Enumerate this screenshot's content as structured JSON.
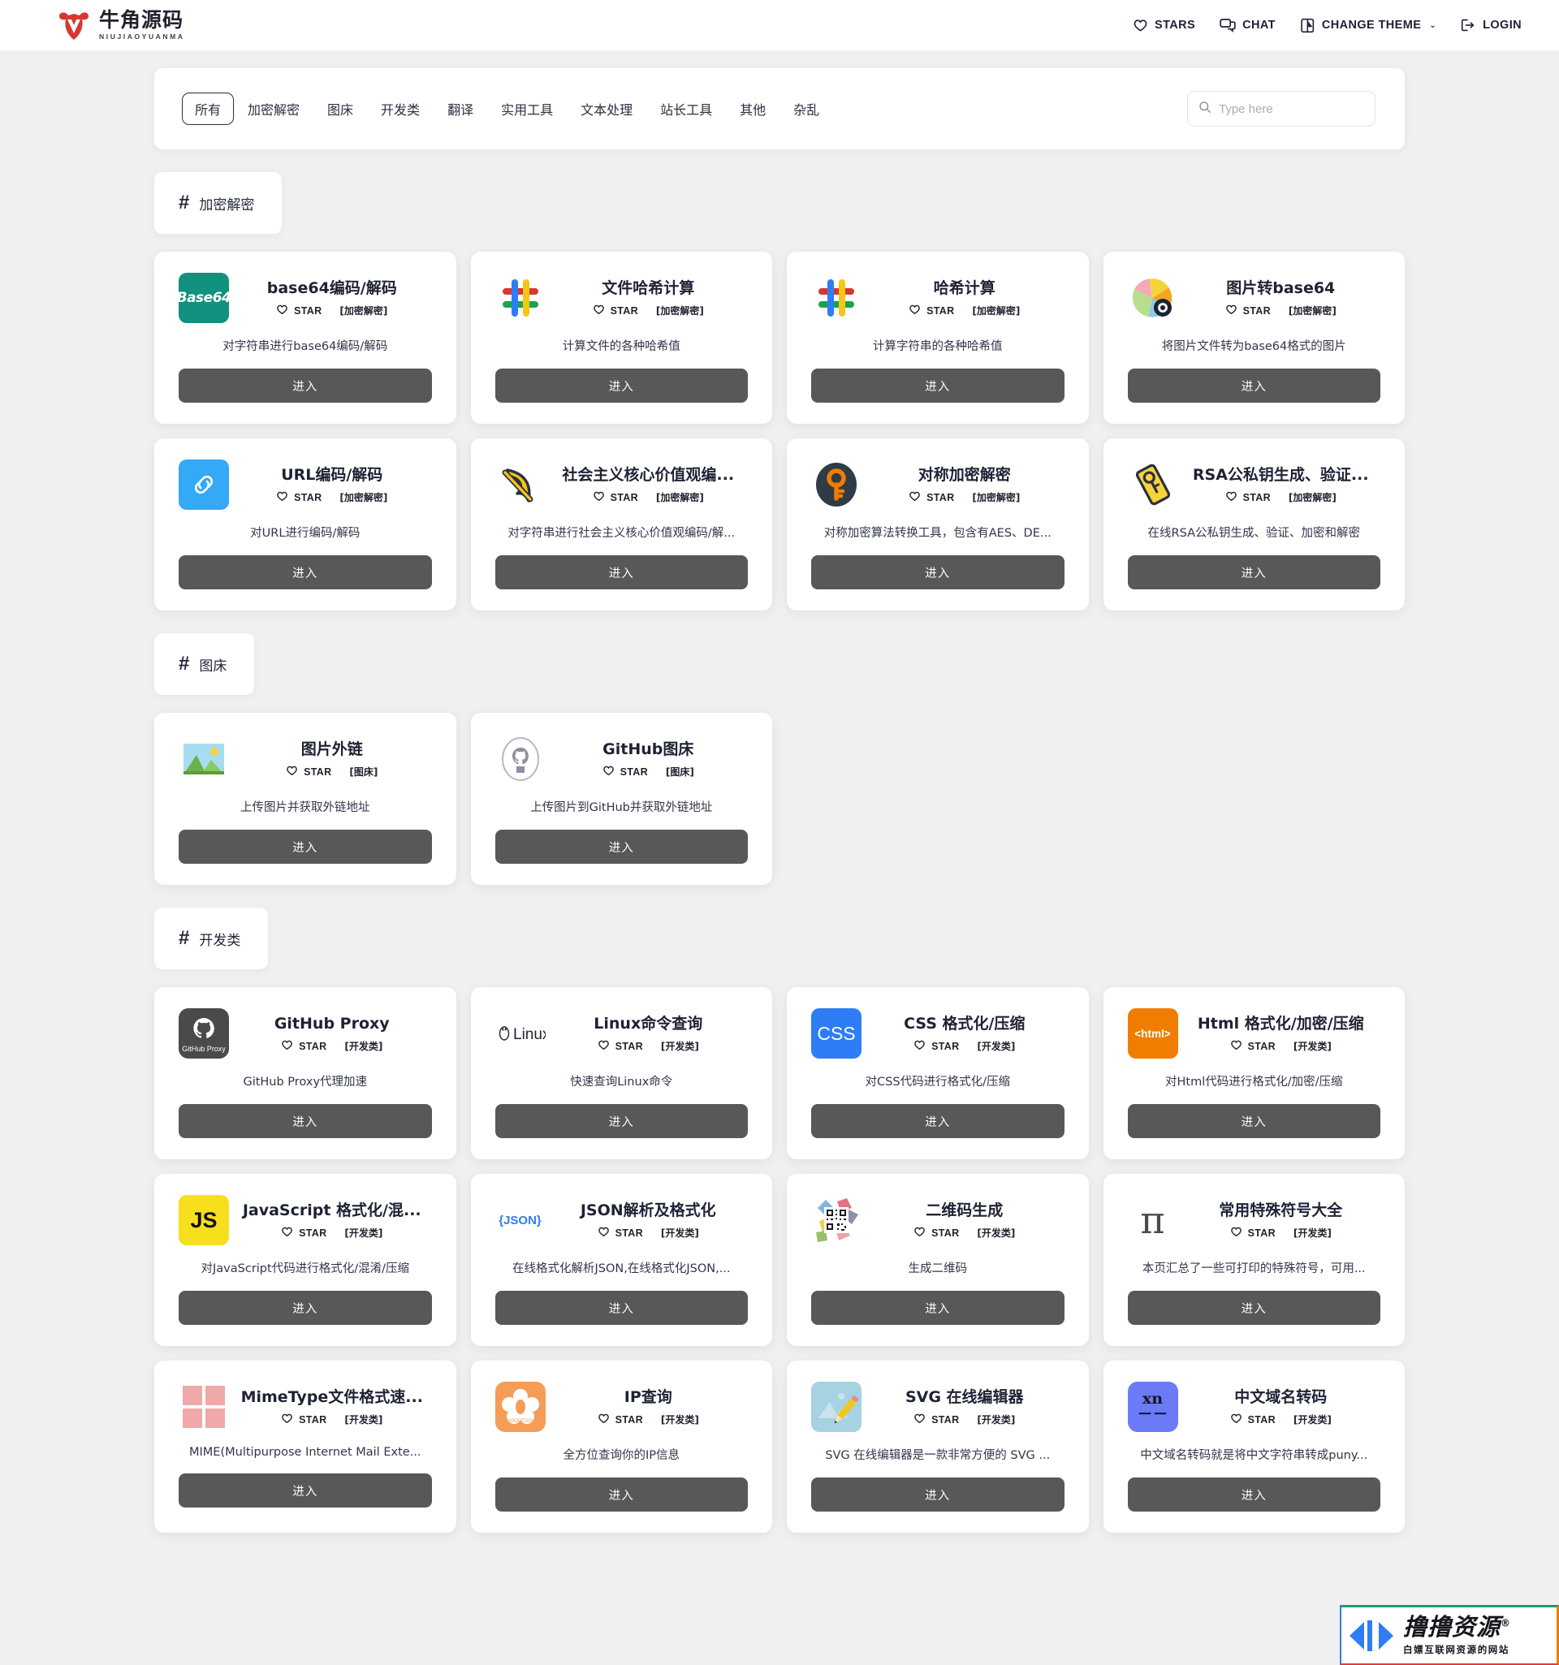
{
  "header": {
    "brand_cn": "牛角源码",
    "brand_en": "NIUJIAOYUANMA",
    "nav": [
      {
        "label": "STARS",
        "icon": "heart-icon"
      },
      {
        "label": "CHAT",
        "icon": "chat-icon"
      },
      {
        "label": "CHANGE THEME",
        "icon": "theme-icon",
        "caret": "⌄"
      },
      {
        "label": "LOGIN",
        "icon": "login-icon"
      }
    ]
  },
  "filter": {
    "tabs": [
      "所有",
      "加密解密",
      "图床",
      "开发类",
      "翻译",
      "实用工具",
      "文本处理",
      "站长工具",
      "其他",
      "杂乱"
    ],
    "active_tab": "所有",
    "search_placeholder": "Type here",
    "search_value": "",
    "search_icon": "search-icon"
  },
  "labels": {
    "star": "STAR",
    "enter": "进入",
    "hash": "#"
  },
  "sections": [
    {
      "id": "encrypt",
      "title": "加密解密",
      "cards": [
        {
          "title": "base64编码/解码",
          "category": "[加密解密]",
          "desc": "对字符串进行base64编码/解码",
          "icon": "base64-icon"
        },
        {
          "title": "文件哈希计算",
          "category": "[加密解密]",
          "desc": "计算文件的各种哈希值",
          "icon": "hash-icon"
        },
        {
          "title": "哈希计算",
          "category": "[加密解密]",
          "desc": "计算字符串的各种哈希值",
          "icon": "hash-icon"
        },
        {
          "title": "图片转base64",
          "category": "[加密解密]",
          "desc": "将图片文件转为base64格式的图片",
          "icon": "image-to-base64-icon"
        },
        {
          "title": "URL编码/解码",
          "category": "[加密解密]",
          "desc": "对URL进行编码/解码",
          "icon": "link-icon"
        },
        {
          "title": "社会主义核心价值观编...",
          "category": "[加密解密]",
          "desc": "对字符串进行社会主义核心价值观编码/解...",
          "icon": "hammer-sickle-icon"
        },
        {
          "title": "对称加密解密",
          "category": "[加密解密]",
          "desc": "对称加密算法转换工具，包含有AES、DE...",
          "icon": "key-icon"
        },
        {
          "title": "RSA公私钥生成、验证...",
          "category": "[加密解密]",
          "desc": "在线RSA公私钥生成、验证、加密和解密",
          "icon": "rsa-tag-icon"
        }
      ]
    },
    {
      "id": "imagehost",
      "title": "图床",
      "cards": [
        {
          "title": "图片外链",
          "category": "[图床]",
          "desc": "上传图片并获取外链地址",
          "icon": "picture-icon"
        },
        {
          "title": "GitHub图床",
          "category": "[图床]",
          "desc": "上传图片到GitHub并获取外链地址",
          "icon": "github-icon"
        }
      ]
    },
    {
      "id": "dev",
      "title": "开发类",
      "cards": [
        {
          "title": "GitHub Proxy",
          "category": "[开发类]",
          "desc": "GitHub Proxy代理加速",
          "icon": "github-proxy-icon"
        },
        {
          "title": "Linux命令查询",
          "category": "[开发类]",
          "desc": "快速查询Linux命令",
          "icon": "linux-icon"
        },
        {
          "title": "CSS 格式化/压缩",
          "category": "[开发类]",
          "desc": "对CSS代码进行格式化/压缩",
          "icon": "css-icon"
        },
        {
          "title": "Html 格式化/加密/压缩",
          "category": "[开发类]",
          "desc": "对Html代码进行格式化/加密/压缩",
          "icon": "html-icon"
        },
        {
          "title": "JavaScript 格式化/混...",
          "category": "[开发类]",
          "desc": "对JavaScript代码进行格式化/混淆/压缩",
          "icon": "javascript-icon"
        },
        {
          "title": "JSON解析及格式化",
          "category": "[开发类]",
          "desc": "在线格式化解析JSON,在线格式化JSON,...",
          "icon": "json-icon"
        },
        {
          "title": "二维码生成",
          "category": "[开发类]",
          "desc": "生成二维码",
          "icon": "qrcode-icon"
        },
        {
          "title": "常用特殊符号大全",
          "category": "[开发类]",
          "desc": "本页汇总了一些可打印的特殊符号，可用...",
          "icon": "pi-icon"
        },
        {
          "title": "MimeType文件格式速...",
          "category": "[开发类]",
          "desc": "MIME(Multipurpose Internet Mail Exte...",
          "icon": "mimetype-icon"
        },
        {
          "title": "IP查询",
          "category": "[开发类]",
          "desc": "全方位查询你的IP信息",
          "icon": "ip-icon"
        },
        {
          "title": "SVG 在线编辑器",
          "category": "[开发类]",
          "desc": "SVG 在线编辑器是一款非常方便的 SVG ...",
          "icon": "svg-editor-icon"
        },
        {
          "title": "中文域名转码",
          "category": "[开发类]",
          "desc": "中文域名转码就是将中文字符串转成puny...",
          "icon": "punycode-icon"
        }
      ]
    }
  ],
  "watermark": {
    "main": "撸撸资源",
    "reg": "®",
    "sub": "白嫖互联网资源的网站"
  },
  "colors": {
    "brand_red": "#d7372f",
    "button_gray": "#58585a",
    "page_bg": "#f0f0f0",
    "card_bg": "#ffffff",
    "text": "#1e2235"
  }
}
